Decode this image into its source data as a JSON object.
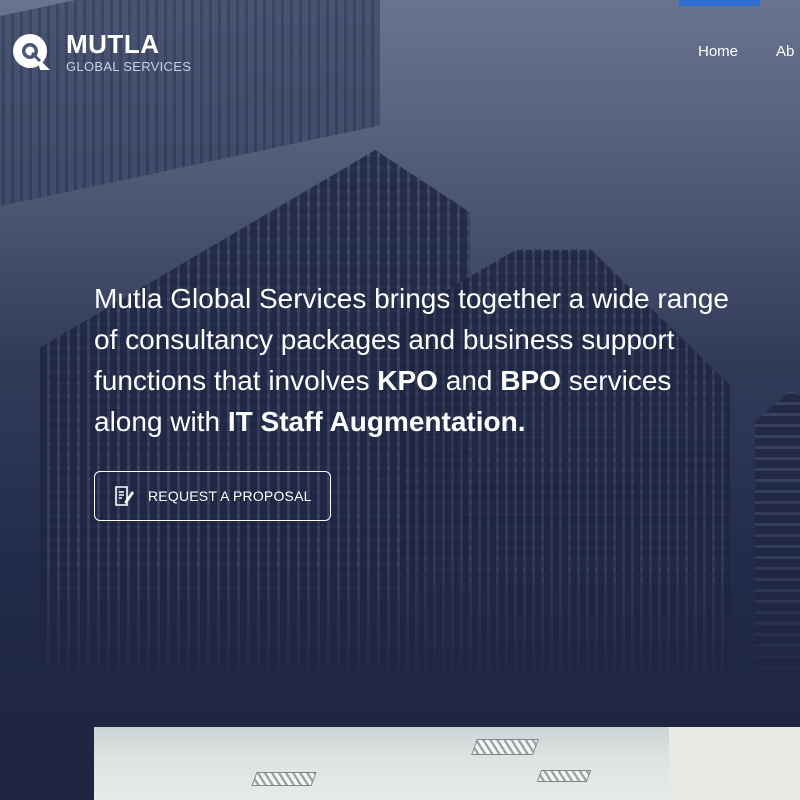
{
  "brand": {
    "name": "MUTLA",
    "tagline": "GLOBAL SERVICES",
    "logo_icon": "q-pin-logo-icon"
  },
  "nav": {
    "items": [
      {
        "label": "Home"
      },
      {
        "label": "Ab"
      }
    ]
  },
  "hero": {
    "segments": [
      {
        "text": "Mutla Global Services brings together a wide range of consultancy packages and business support functions that involves ",
        "bold": false
      },
      {
        "text": "KPO",
        "bold": true
      },
      {
        "text": " and ",
        "bold": false
      },
      {
        "text": "BPO",
        "bold": true
      },
      {
        "text": " services along with ",
        "bold": false
      },
      {
        "text": "IT Staff Augmentation.",
        "bold": true
      }
    ]
  },
  "cta": {
    "label": "REQUEST A PROPOSAL",
    "icon": "edit-document-icon"
  },
  "colors": {
    "accent": "#2f6fd1",
    "navy": "#1e2644",
    "text": "#ffffff"
  }
}
